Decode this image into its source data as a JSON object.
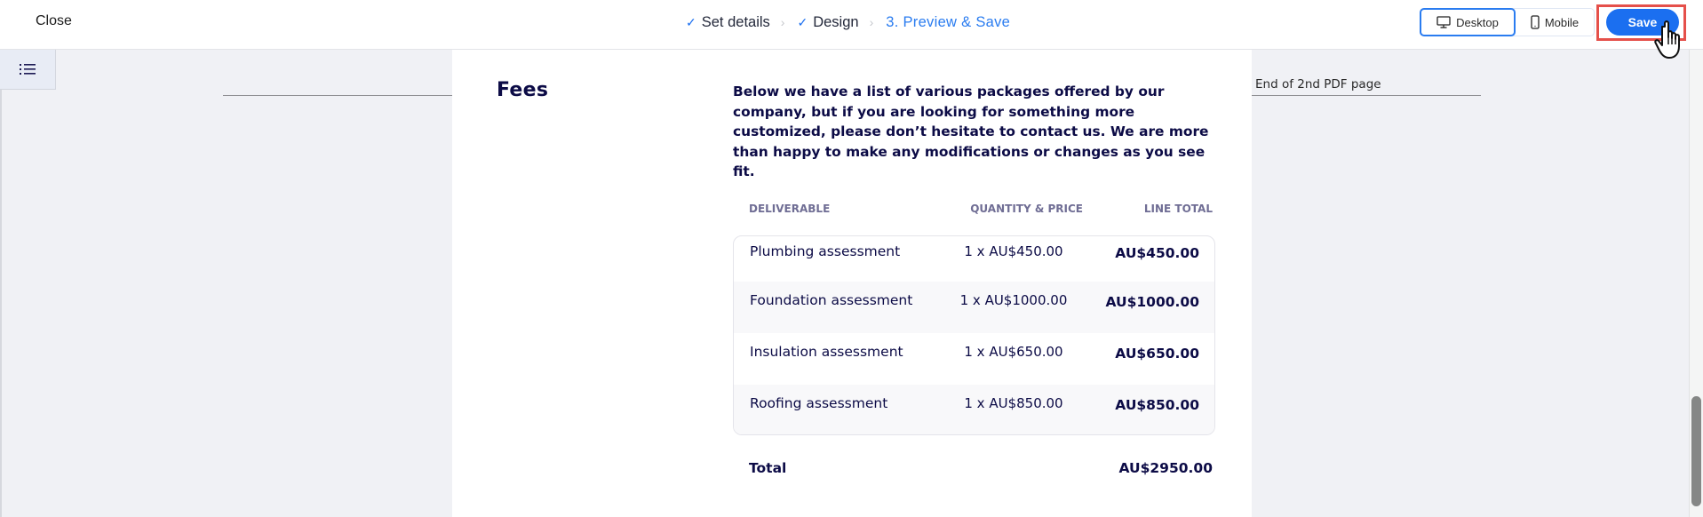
{
  "topbar": {
    "close_label": "Close",
    "steps": [
      {
        "label": "Set details",
        "state": "done",
        "icon": "check-icon"
      },
      {
        "label": "Design",
        "state": "done",
        "icon": "check-icon"
      },
      {
        "label": "3. Preview & Save",
        "state": "active"
      }
    ],
    "view_toggle": {
      "desktop_label": "Desktop",
      "mobile_label": "Mobile",
      "selected": "Desktop"
    },
    "save_label": "Save"
  },
  "preview": {
    "page_break_label": "End of 2nd PDF page",
    "section_title": "Fees",
    "intro": "Below we have a list of various packages offered by our company, but if you are looking for something more customized, please don’t hesitate to contact us. We are more than happy to make any modifications or changes as you see fit.",
    "table": {
      "headers": {
        "deliverable": "DELIVERABLE",
        "quantity_price": "QUANTITY & PRICE",
        "line_total": "LINE TOTAL"
      },
      "rows": [
        {
          "deliverable": "Plumbing assessment",
          "quantity_price": "1 x AU$450.00",
          "line_total": "AU$450.00"
        },
        {
          "deliverable": "Foundation assessment",
          "quantity_price": "1 x AU$1000.00",
          "line_total": "AU$1000.00"
        },
        {
          "deliverable": "Insulation assessment",
          "quantity_price": "1 x AU$650.00",
          "line_total": "AU$650.00"
        },
        {
          "deliverable": "Roofing assessment",
          "quantity_price": "1 x AU$850.00",
          "line_total": "AU$850.00"
        }
      ],
      "total_label": "Total",
      "total_amount": "AU$2950.00"
    }
  },
  "colors": {
    "accent": "#1b6ff0",
    "heading": "#0c0b46",
    "header_muted": "#6f6d94",
    "highlight": "#e5504a"
  }
}
